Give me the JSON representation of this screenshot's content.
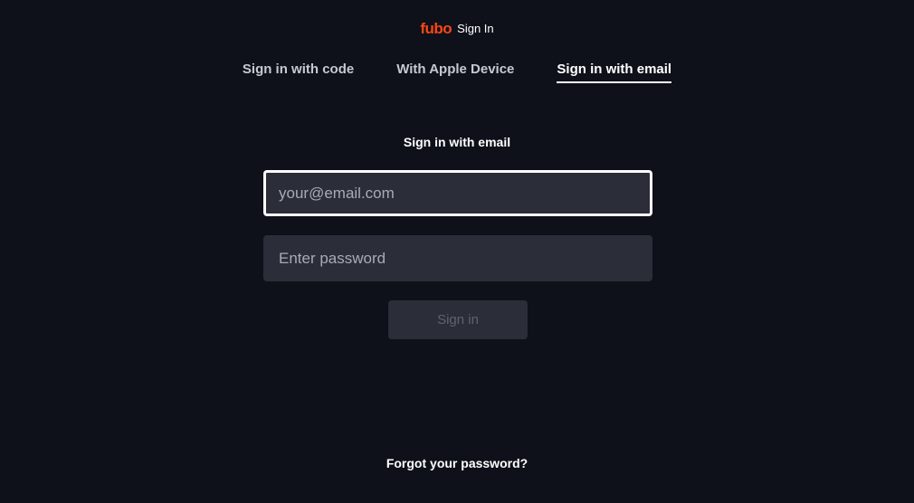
{
  "header": {
    "logo_text": "fubo",
    "title": "Sign In"
  },
  "tabs": [
    {
      "label": "Sign in with code",
      "active": false
    },
    {
      "label": "With Apple Device",
      "active": false
    },
    {
      "label": "Sign in with email",
      "active": true
    }
  ],
  "form": {
    "heading": "Sign in with email",
    "email": {
      "value": "",
      "placeholder": "your@email.com"
    },
    "password": {
      "value": "",
      "placeholder": "Enter password"
    },
    "submit_label": "Sign in"
  },
  "footer": {
    "forgot_label": "Forgot your password?"
  },
  "colors": {
    "background": "#0e111a",
    "brand": "#fa4616",
    "field_background": "#2b2e39",
    "focus_border": "#ffffff"
  }
}
